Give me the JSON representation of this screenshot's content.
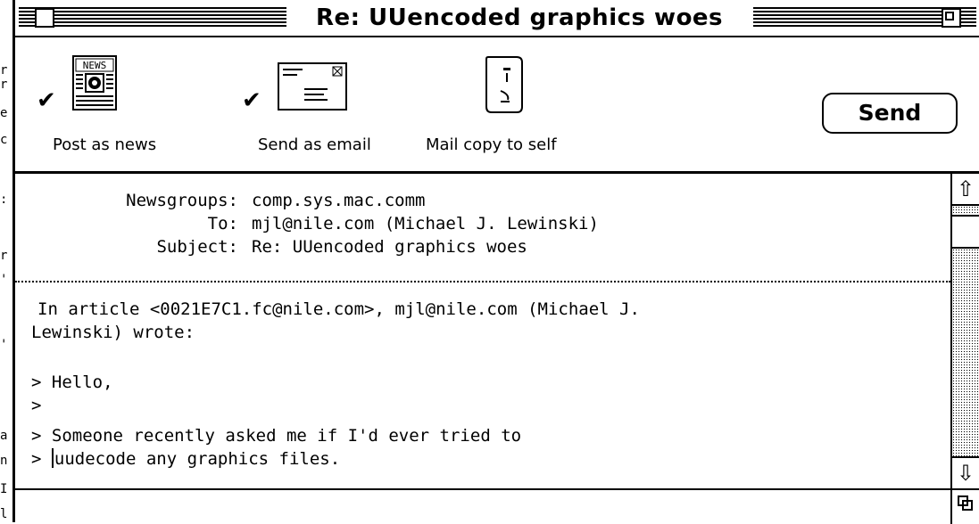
{
  "window": {
    "title": "Re: UUencoded graphics woes"
  },
  "toolbar": {
    "post_as_news": {
      "label": "Post as news",
      "checked": true,
      "icon": "newspaper-icon"
    },
    "send_as_email": {
      "label": "Send as email",
      "checked": true,
      "icon": "envelope-icon"
    },
    "mail_copy_to_self": {
      "label": "Mail copy to self",
      "checked": false,
      "icon": "face-icon"
    },
    "send_label": "Send",
    "check_glyph": "✔"
  },
  "headers": {
    "newsgroups_label": "Newsgroups:",
    "newsgroups_value": "comp.sys.mac.comm",
    "to_label": "To:",
    "to_value": "mjl@nile.com (Michael J. Lewinski)",
    "subject_label": "Subject:",
    "subject_value": "Re: UUencoded graphics woes"
  },
  "body": {
    "line1": "In article <0021E7C1.fc@nile.com>, mjl@nile.com (Michael J.",
    "line2": "Lewinski) wrote:",
    "line3": "",
    "line4": "> Hello,",
    "line5": ">",
    "line6": "> Someone recently asked me if I'd ever tried to",
    "line7_prefix": "> ",
    "line7_rest": "uudecode any graphics files."
  },
  "background_window": {
    "fragments": [
      "r",
      "r",
      "e",
      "c",
      ":",
      "r",
      "'",
      "'",
      "a",
      "n",
      "I",
      "l"
    ]
  },
  "scrollbar": {
    "up_glyph": "⇧",
    "down_glyph": "⇩"
  },
  "colors": {
    "foreground": "#000000",
    "background": "#ffffff"
  }
}
